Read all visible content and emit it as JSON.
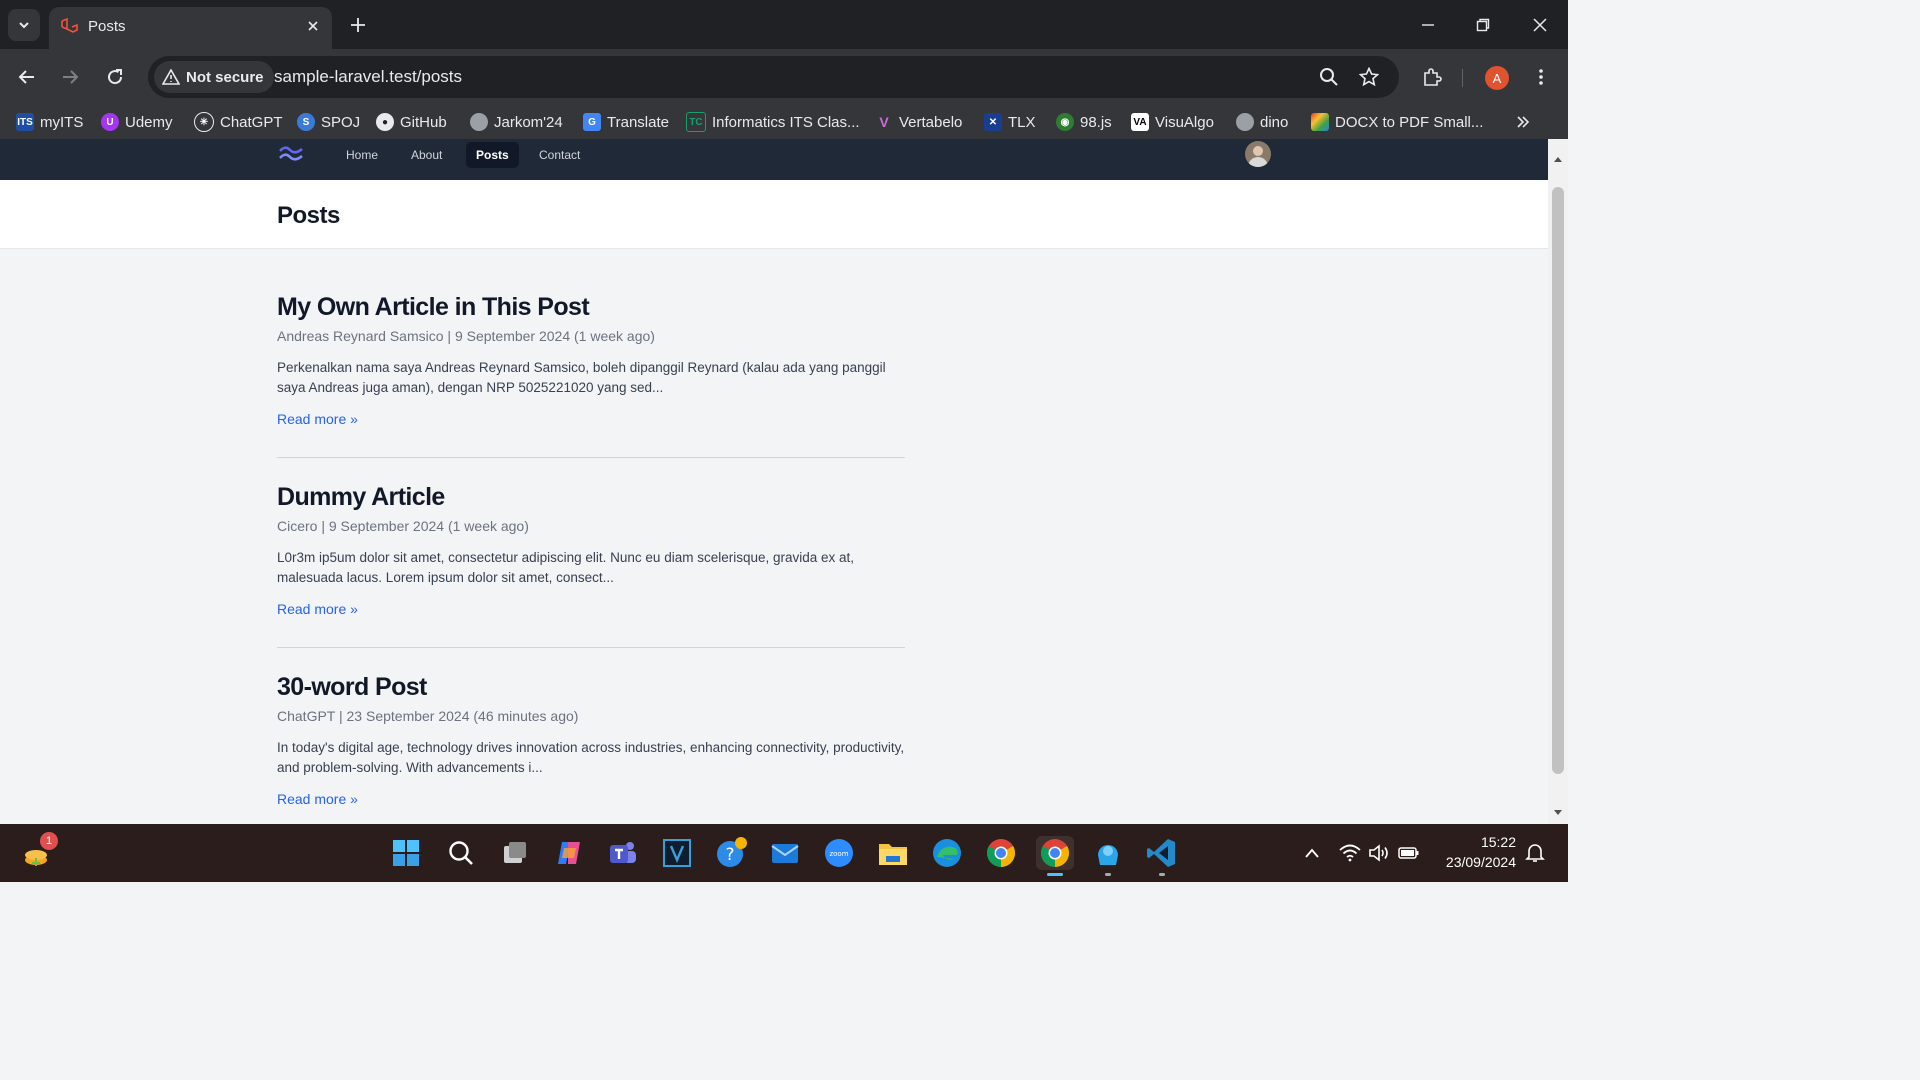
{
  "browser": {
    "tab_title": "Posts",
    "secure_label": "Not secure",
    "url": "sample-laravel.test/posts",
    "profile_initial": "A",
    "bookmarks": [
      {
        "label": "myITS",
        "icon": "its-icon",
        "color": "#1e4fa3"
      },
      {
        "label": "Udemy",
        "icon": "udemy-icon",
        "color": "#a435f0"
      },
      {
        "label": "ChatGPT",
        "icon": "chatgpt-icon",
        "color": "#202124"
      },
      {
        "label": "SPOJ",
        "icon": "spoj-icon",
        "color": "#3b7bd8"
      },
      {
        "label": "GitHub",
        "icon": "github-icon",
        "color": "#202124"
      },
      {
        "label": "Jarkom'24",
        "icon": "globe-icon",
        "color": "#9aa0a6"
      },
      {
        "label": "Translate",
        "icon": "translate-icon",
        "color": "#4285f4"
      },
      {
        "label": "Informatics ITS Clas...",
        "icon": "tc-icon",
        "color": "#1a9e6b"
      },
      {
        "label": "Vertabelo",
        "icon": "vertabelo-icon",
        "color": "#8e44ad"
      },
      {
        "label": "TLX",
        "icon": "tlx-icon",
        "color": "#1a3d8f"
      },
      {
        "label": "98.js",
        "icon": "windows98-icon",
        "color": "#2e7d32"
      },
      {
        "label": "VisuAlgo",
        "icon": "visualgo-icon",
        "color": "#000000"
      },
      {
        "label": "dino",
        "icon": "globe-icon",
        "color": "#9aa0a6"
      },
      {
        "label": "DOCX to PDF Small...",
        "icon": "smallpdf-icon",
        "color": "#e53935"
      }
    ]
  },
  "site": {
    "nav": [
      "Home",
      "About",
      "Posts",
      "Contact"
    ],
    "active_nav": "Posts",
    "page_title": "Posts",
    "posts": [
      {
        "title": "My Own Article in This Post",
        "meta": "Andreas Reynard Samsico | 9 September 2024 (1 week ago)",
        "excerpt": "Perkenalkan nama saya Andreas Reynard Samsico, boleh dipanggil Reynard (kalau ada yang panggil saya Andreas juga aman), dengan NRP 5025221020 yang sed...",
        "read_more": "Read more »"
      },
      {
        "title": "Dummy Article",
        "meta": "Cicero | 9 September 2024 (1 week ago)",
        "excerpt": "L0r3m ip5um dolor sit amet, consectetur adipiscing elit. Nunc eu diam scelerisque, gravida ex at, malesuada lacus. Lorem ipsum dolor sit amet, consect...",
        "read_more": "Read more »"
      },
      {
        "title": "30-word Post",
        "meta": "ChatGPT | 23 September 2024 (46 minutes ago)",
        "excerpt": "In today's digital age, technology drives innovation across industries, enhancing connectivity, productivity, and problem-solving. With advancements i...",
        "read_more": "Read more »"
      }
    ]
  },
  "taskbar": {
    "notification_count": "1",
    "time": "15:22",
    "date": "23/09/2024",
    "apps": [
      "start-icon",
      "search-icon",
      "task-view-icon",
      "copilot-icon",
      "teams-icon",
      "vim-icon",
      "help-icon",
      "mail-icon",
      "zoom-icon",
      "file-explorer-icon",
      "edge-icon",
      "chrome-icon",
      "chrome-active-icon",
      "weather-icon",
      "vscode-icon"
    ]
  }
}
